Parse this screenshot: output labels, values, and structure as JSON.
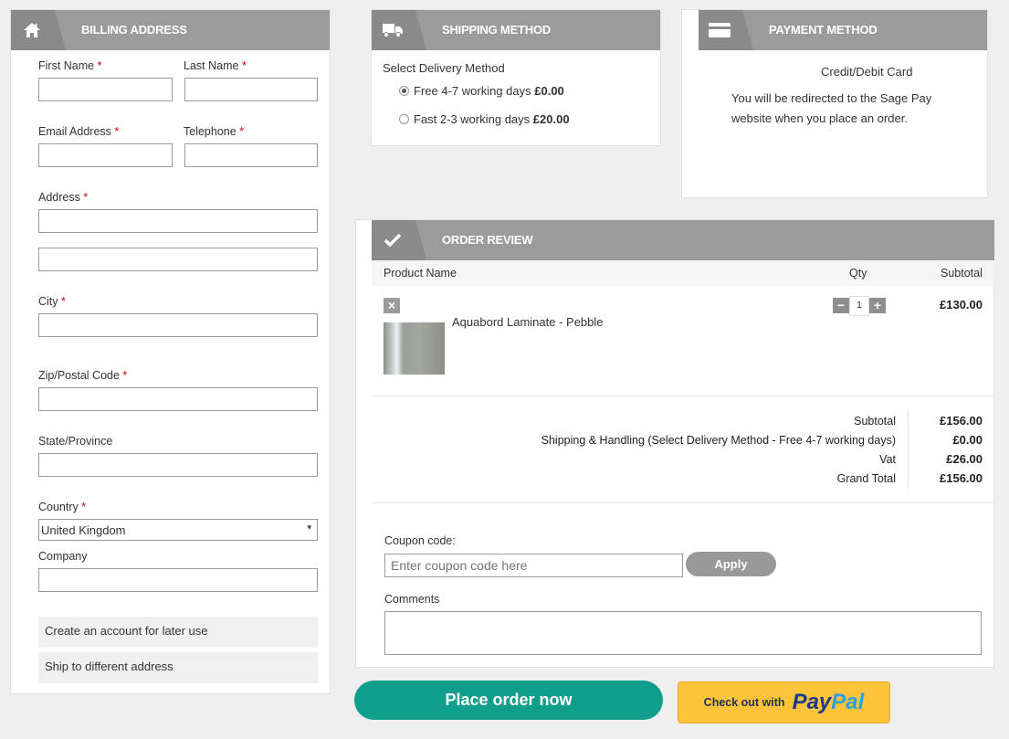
{
  "billing": {
    "title": "BILLING ADDRESS",
    "first_name": "First Name",
    "last_name": "Last Name",
    "email": "Email Address",
    "telephone": "Telephone",
    "address": "Address",
    "city": "City",
    "zip": "Zip/Postal Code",
    "state": "State/Province",
    "country": "Country",
    "country_value": "United Kingdom",
    "company": "Company",
    "create_account": "Create an account for later use",
    "ship_different": "Ship to different address",
    "required_mark": "*"
  },
  "shipping": {
    "title": "SHIPPING METHOD",
    "select_label": "Select Delivery Method",
    "options": [
      {
        "label": "Free 4-7 working days",
        "price": "£0.00",
        "selected": true
      },
      {
        "label": "Fast 2-3 working days",
        "price": "£20.00",
        "selected": false
      }
    ]
  },
  "payment": {
    "title": "PAYMENT METHOD",
    "method": "Credit/Debit Card",
    "note_line1": "You will be redirected to the Sage Pay",
    "note_line2": "website when you place an order."
  },
  "review": {
    "title": "ORDER REVIEW",
    "col_product": "Product Name",
    "col_qty": "Qty",
    "col_subtotal": "Subtotal",
    "item": {
      "name": "Aquabord Laminate - Pebble",
      "qty": "1",
      "subtotal": "£130.00",
      "remove": "×",
      "minus": "−",
      "plus": "+"
    },
    "totals": [
      {
        "label": "Subtotal",
        "value": "£156.00"
      },
      {
        "label": "Shipping & Handling (Select Delivery Method - Free 4-7 working days)",
        "value": "£0.00"
      },
      {
        "label": "Vat",
        "value": "£26.00"
      },
      {
        "label": "Grand Total",
        "value": "£156.00"
      }
    ],
    "coupon_label": "Coupon code:",
    "coupon_placeholder": "Enter coupon code here",
    "apply": "Apply",
    "comments_label": "Comments"
  },
  "actions": {
    "place_order": "Place order now",
    "paypal_prefix": "Check out with",
    "paypal_brand_a": "Pay",
    "paypal_brand_b": "Pal"
  },
  "colors": {
    "header": "#9b9b9b",
    "accent": "#109e8c",
    "required": "#cc0000",
    "paypal": "#fdc33a"
  }
}
